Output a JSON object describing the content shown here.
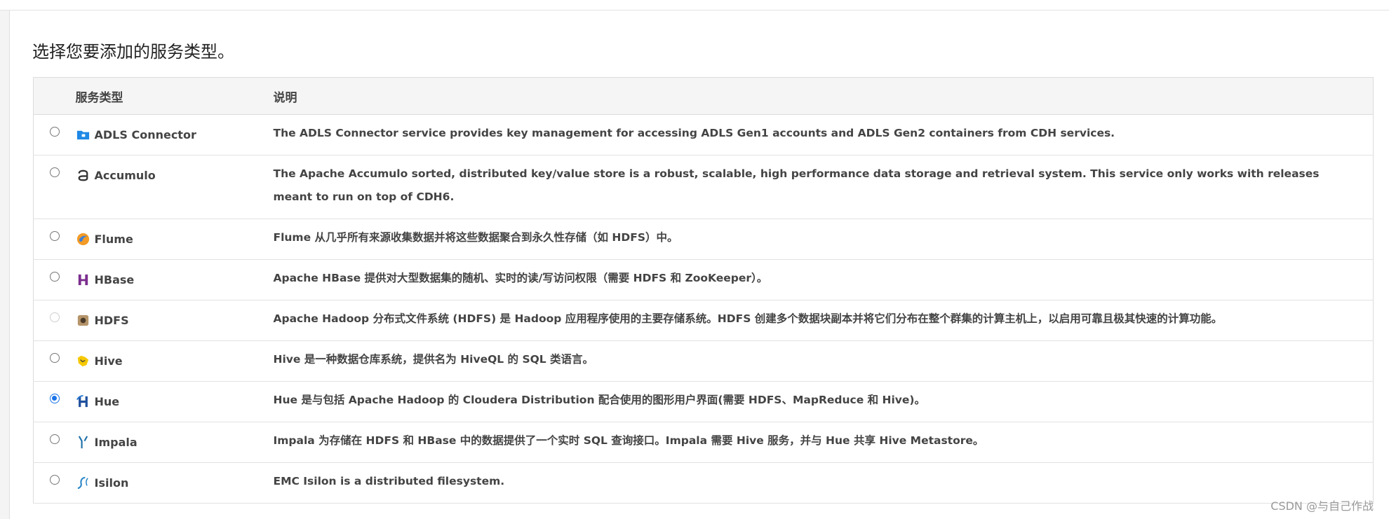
{
  "heading": "选择您要添加的服务类型。",
  "columns": {
    "type": "服务类型",
    "desc": "说明"
  },
  "services": [
    {
      "name": "ADLS Connector",
      "desc": "The ADLS Connector service provides key management for accessing ADLS Gen1 accounts and ADLS Gen2 containers from CDH services.",
      "selected": false,
      "disabled": false,
      "icon": "folder-icon"
    },
    {
      "name": "Accumulo",
      "desc": "The Apache Accumulo sorted, distributed key/value store is a robust, scalable, high performance data storage and retrieval system. This service only works with releases meant to run on top of CDH6.",
      "selected": false,
      "disabled": false,
      "icon": "accumulo-icon"
    },
    {
      "name": "Flume",
      "desc": "Flume 从几乎所有来源收集数据并将这些数据聚合到永久性存储（如 HDFS）中。",
      "selected": false,
      "disabled": false,
      "icon": "flume-icon"
    },
    {
      "name": "HBase",
      "desc": "Apache HBase 提供对大型数据集的随机、实时的读/写访问权限（需要 HDFS 和 ZooKeeper）。",
      "selected": false,
      "disabled": false,
      "icon": "hbase-icon"
    },
    {
      "name": "HDFS",
      "desc": "Apache Hadoop 分布式文件系统 (HDFS) 是 Hadoop 应用程序使用的主要存储系统。HDFS 创建多个数据块副本并将它们分布在整个群集的计算主机上，以启用可靠且极其快速的计算功能。",
      "selected": false,
      "disabled": true,
      "icon": "hdfs-icon"
    },
    {
      "name": "Hive",
      "desc": "Hive 是一种数据仓库系统，提供名为 HiveQL 的 SQL 类语言。",
      "selected": false,
      "disabled": false,
      "icon": "hive-icon"
    },
    {
      "name": "Hue",
      "desc": "Hue 是与包括 Apache Hadoop 的 Cloudera Distribution 配合使用的图形用户界面(需要 HDFS、MapReduce 和 Hive)。",
      "selected": true,
      "disabled": false,
      "icon": "hue-icon"
    },
    {
      "name": "Impala",
      "desc": "Impala 为存储在 HDFS 和 HBase 中的数据提供了一个实时 SQL 查询接口。Impala 需要 Hive 服务，并与 Hue 共享 Hive Metastore。",
      "selected": false,
      "disabled": false,
      "icon": "impala-icon"
    },
    {
      "name": "Isilon",
      "desc": "EMC Isilon is a distributed filesystem.",
      "selected": false,
      "disabled": false,
      "icon": "isilon-icon"
    }
  ],
  "watermark": "CSDN @与自己作战",
  "colors": {
    "accent": "#1a73e8",
    "header_bg": "#f5f5f5"
  }
}
